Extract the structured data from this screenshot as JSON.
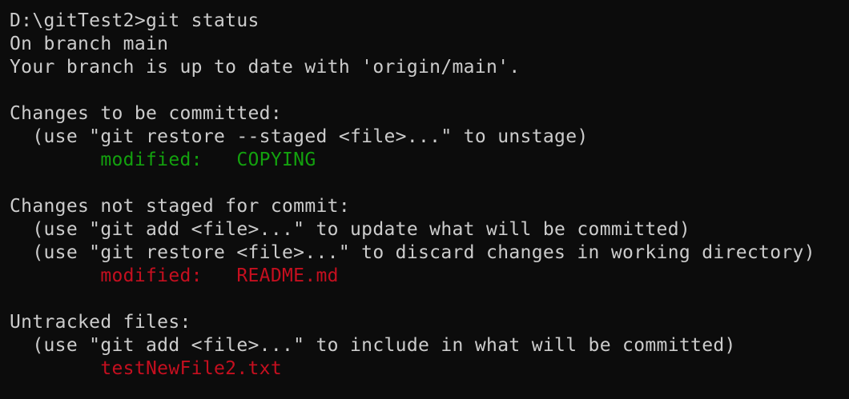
{
  "terminal": {
    "prompt_line": "D:\\gitTest2>git status",
    "branch_line": "On branch main",
    "upstream_line": "Your branch is up to date with 'origin/main'.",
    "staged": {
      "header": "Changes to be committed:",
      "hint": "  (use \"git restore --staged <file>...\" to unstage)",
      "entry_status": "        modified:   ",
      "entry_file": "COPYING",
      "color": "#13a10e"
    },
    "unstaged": {
      "header": "Changes not staged for commit:",
      "hint1": "  (use \"git add <file>...\" to update what will be committed)",
      "hint2": "  (use \"git restore <file>...\" to discard changes in working directory)",
      "entry_status": "        modified:   ",
      "entry_file": "README.md",
      "color": "#c50f1f"
    },
    "untracked": {
      "header": "Untracked files:",
      "hint": "  (use \"git add <file>...\" to include in what will be committed)",
      "entry_indent": "        ",
      "entry_file": "testNewFile2.txt",
      "color": "#c50f1f"
    },
    "colors": {
      "background": "#0c0c0c",
      "foreground": "#cccccc"
    }
  }
}
